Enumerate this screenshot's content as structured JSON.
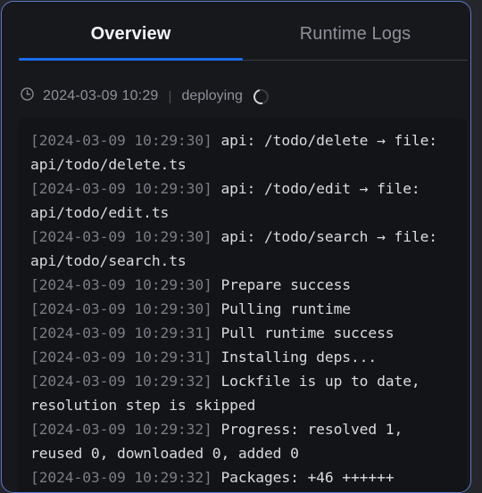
{
  "window": {
    "background_color": "#24262b",
    "panel_color": "#17181c",
    "focus_ring_color": "#5b79c9"
  },
  "tabs": {
    "active_index": 0,
    "accent_color": "#1a6cf0",
    "items": [
      {
        "label": "Overview",
        "active": true
      },
      {
        "label": "Runtime Logs",
        "active": false
      }
    ]
  },
  "status": {
    "clock_icon": "clock-icon",
    "timestamp": "2024-03-09 10:29",
    "separator": "|",
    "state": "deploying",
    "spinner_icon": "spinner-icon"
  },
  "log": {
    "background_color": "#131417",
    "timestamp_color": "#797c85",
    "message_color": "#d9dbe1",
    "lines": [
      {
        "ts": "[2024-03-09 10:29:30]",
        "msg": "api: /todo/delete → file: api/todo/delete.ts"
      },
      {
        "ts": "[2024-03-09 10:29:30]",
        "msg": "api: /todo/edit → file: api/todo/edit.ts"
      },
      {
        "ts": "[2024-03-09 10:29:30]",
        "msg": "api: /todo/search → file: api/todo/search.ts"
      },
      {
        "ts": "[2024-03-09 10:29:30]",
        "msg": "Prepare success"
      },
      {
        "ts": "[2024-03-09 10:29:30]",
        "msg": "Pulling runtime"
      },
      {
        "ts": "[2024-03-09 10:29:31]",
        "msg": "Pull runtime success"
      },
      {
        "ts": "[2024-03-09 10:29:31]",
        "msg": "Installing deps..."
      },
      {
        "ts": "[2024-03-09 10:29:32]",
        "msg": "Lockfile is up to date, resolution step is skipped"
      },
      {
        "ts": "[2024-03-09 10:29:32]",
        "msg": "Progress: resolved 1, reused 0, downloaded 0, added 0"
      },
      {
        "ts": "[2024-03-09 10:29:32]",
        "msg": "Packages: +46 ++++++"
      }
    ]
  }
}
